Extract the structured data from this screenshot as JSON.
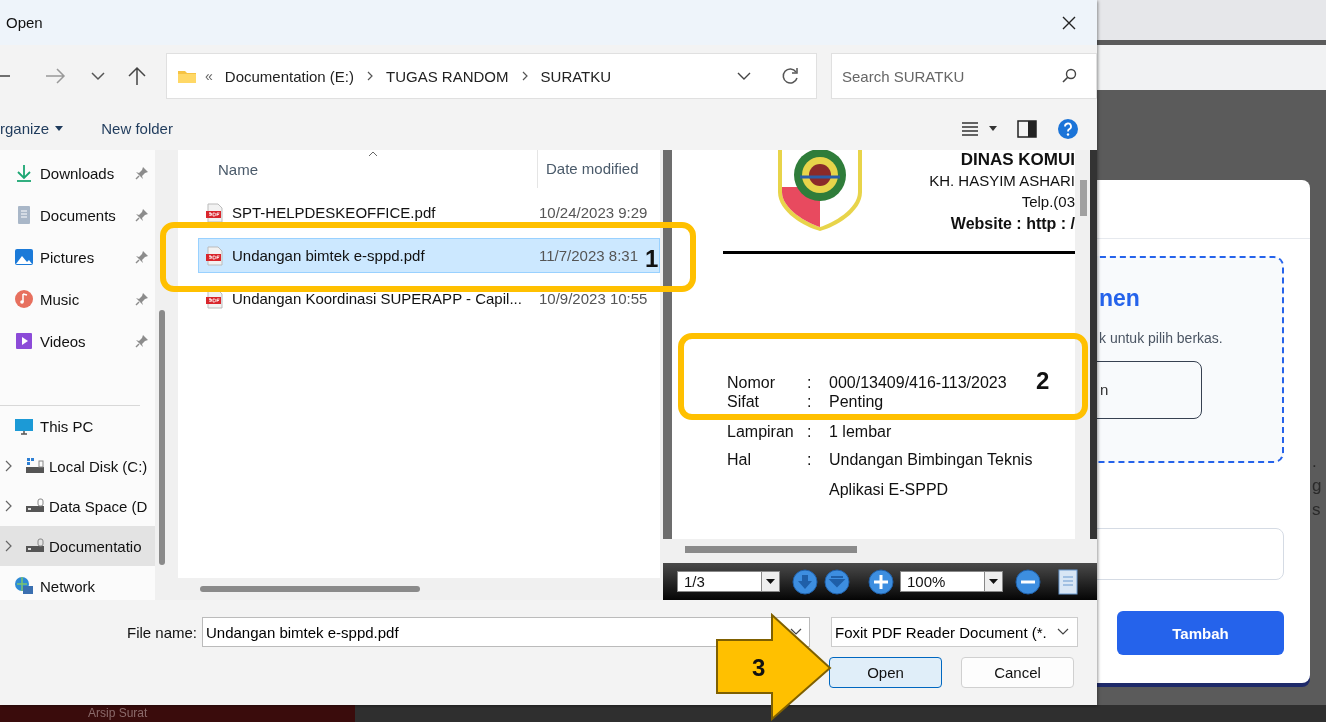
{
  "dialog": {
    "title": "Open",
    "address": {
      "overflow": "«",
      "crumbs": [
        "Documentation (E:)",
        "TUGAS RANDOM",
        "SURATKU"
      ]
    },
    "search": {
      "placeholder": "Search SURATKU"
    },
    "commands": [
      {
        "label": "rganize",
        "kind": "menu"
      },
      {
        "label": "New folder",
        "kind": "plain"
      }
    ],
    "nav_groups": [
      {
        "items": [
          {
            "label": "Downloads",
            "kind": "download",
            "pinned": true,
            "expandable": false,
            "selected": false
          },
          {
            "label": "Documents",
            "kind": "documents",
            "pinned": true,
            "expandable": false,
            "selected": false
          },
          {
            "label": "Pictures",
            "kind": "pictures",
            "pinned": true,
            "expandable": false,
            "selected": false
          },
          {
            "label": "Music",
            "kind": "music",
            "pinned": true,
            "expandable": false,
            "selected": false
          },
          {
            "label": "Videos",
            "kind": "videos",
            "pinned": true,
            "expandable": false,
            "selected": false
          }
        ]
      },
      {
        "items": [
          {
            "label": "This PC",
            "kind": "pc",
            "pinned": false,
            "expandable": false,
            "selected": false
          },
          {
            "label": "Local Disk (C:)",
            "kind": "system-disk",
            "pinned": false,
            "expandable": true,
            "selected": false
          },
          {
            "label": "Data Space (D",
            "kind": "disk",
            "pinned": false,
            "expandable": true,
            "selected": false
          },
          {
            "label": "Documentatio",
            "kind": "disk",
            "pinned": false,
            "expandable": true,
            "selected": true
          },
          {
            "label": "Network",
            "kind": "network",
            "pinned": false,
            "expandable": false,
            "selected": false
          }
        ]
      }
    ],
    "columns": [
      "Name",
      "Date modified"
    ],
    "files": [
      {
        "name": "SPT-HELPDESKEOFFICE.pdf",
        "date": "10/24/2023 9:29",
        "selected": false
      },
      {
        "name": "Undangan bimtek e-sppd.pdf",
        "date": "11/7/2023 8:31",
        "selected": true
      },
      {
        "name": "Undangan Koordinasi SUPERAPP - Capil...",
        "date": "10/9/2023 10:55",
        "selected": false
      }
    ],
    "preview": {
      "org_lines": [
        {
          "text": "DINAS KOMUI",
          "kind": "title"
        },
        {
          "text": "KH. HASYIM ASHARI",
          "kind": "plain"
        },
        {
          "text": "Telp.(03",
          "kind": "plain"
        },
        {
          "text": "Website : http : /",
          "kind": "bold"
        }
      ],
      "fields": [
        {
          "label": "Nomor",
          "colon": ":",
          "value": "000/13409/416-113/2023"
        },
        {
          "label": "Sifat",
          "colon": ":",
          "value": "Penting"
        },
        {
          "label": "Lampiran",
          "colon": ":",
          "value": "1 lembar"
        },
        {
          "label": "Hal",
          "colon": ":",
          "value": "Undangan Bimbingan Teknis"
        },
        {
          "value": "Aplikasi E-SPPD"
        }
      ]
    },
    "pdf_toolbar": {
      "page": "1/3",
      "zoom": "100%"
    },
    "file_name": {
      "label": "File name:",
      "value": "Undangan bimtek e-sppd.pdf"
    },
    "file_type": "Foxit PDF Reader Document (*.",
    "buttons": [
      {
        "label": "Open",
        "kind": "default"
      },
      {
        "label": "Cancel",
        "kind": "normal"
      }
    ]
  },
  "behind": {
    "modal": {
      "heading": "nen",
      "hint": "k untuk pilih berkas.",
      "pick_button": "n",
      "submit": "Tambah"
    },
    "edge_texts": [
      ".",
      "g",
      "s"
    ],
    "tab": "Arsip Surat"
  },
  "callouts": [
    {
      "kind": "box",
      "number": "1"
    },
    {
      "kind": "box",
      "number": "2"
    },
    {
      "kind": "arrow",
      "number": "3"
    }
  ]
}
